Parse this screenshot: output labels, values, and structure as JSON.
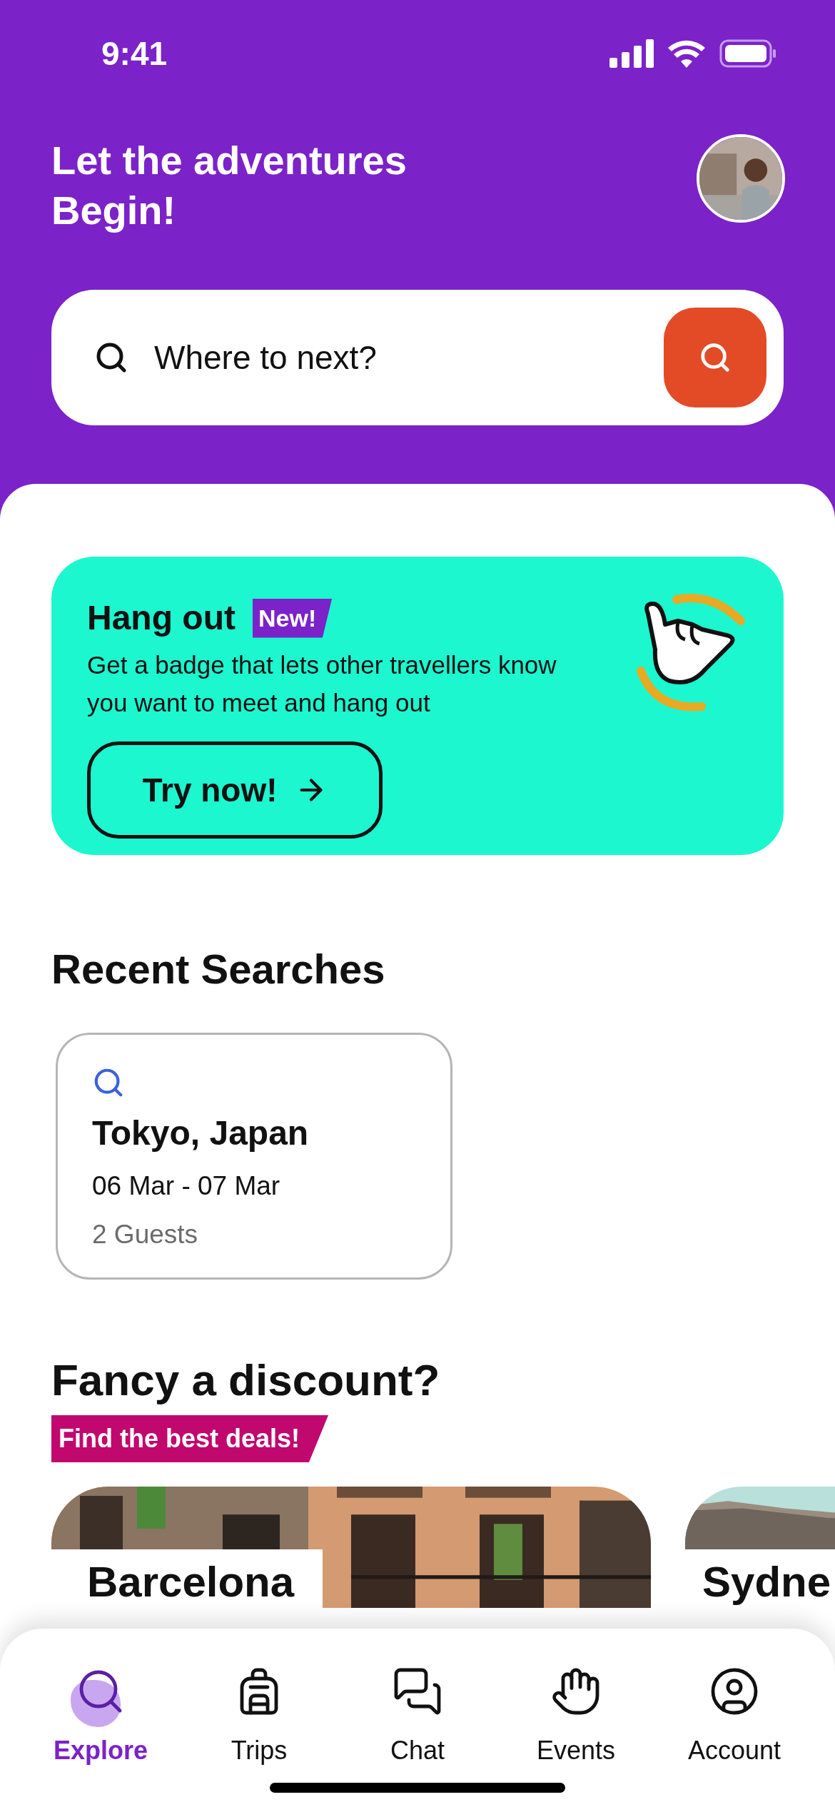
{
  "status_bar": {
    "time": "9:41"
  },
  "header": {
    "title": "Let the adventures Begin!"
  },
  "search": {
    "placeholder": "Where to next?"
  },
  "promo": {
    "title": "Hang out",
    "badge": "New!",
    "text": "Get a badge that lets other travellers know you want to meet and hang out",
    "button": "Try now!"
  },
  "recent_searches": {
    "title": "Recent Searches",
    "items": [
      {
        "place": "Tokyo, Japan",
        "dates": "06 Mar - 07 Mar",
        "guests": "2 Guests"
      }
    ]
  },
  "discounts": {
    "title": "Fancy a discount?",
    "tag": "Find the best deals!",
    "cards": [
      {
        "name": "Barcelona"
      },
      {
        "name": "Sydne"
      }
    ]
  },
  "tab_bar": [
    {
      "label": "Explore",
      "selected": true
    },
    {
      "label": "Trips",
      "selected": false
    },
    {
      "label": "Chat",
      "selected": false
    },
    {
      "label": "Events",
      "selected": false
    },
    {
      "label": "Account",
      "selected": false
    }
  ]
}
